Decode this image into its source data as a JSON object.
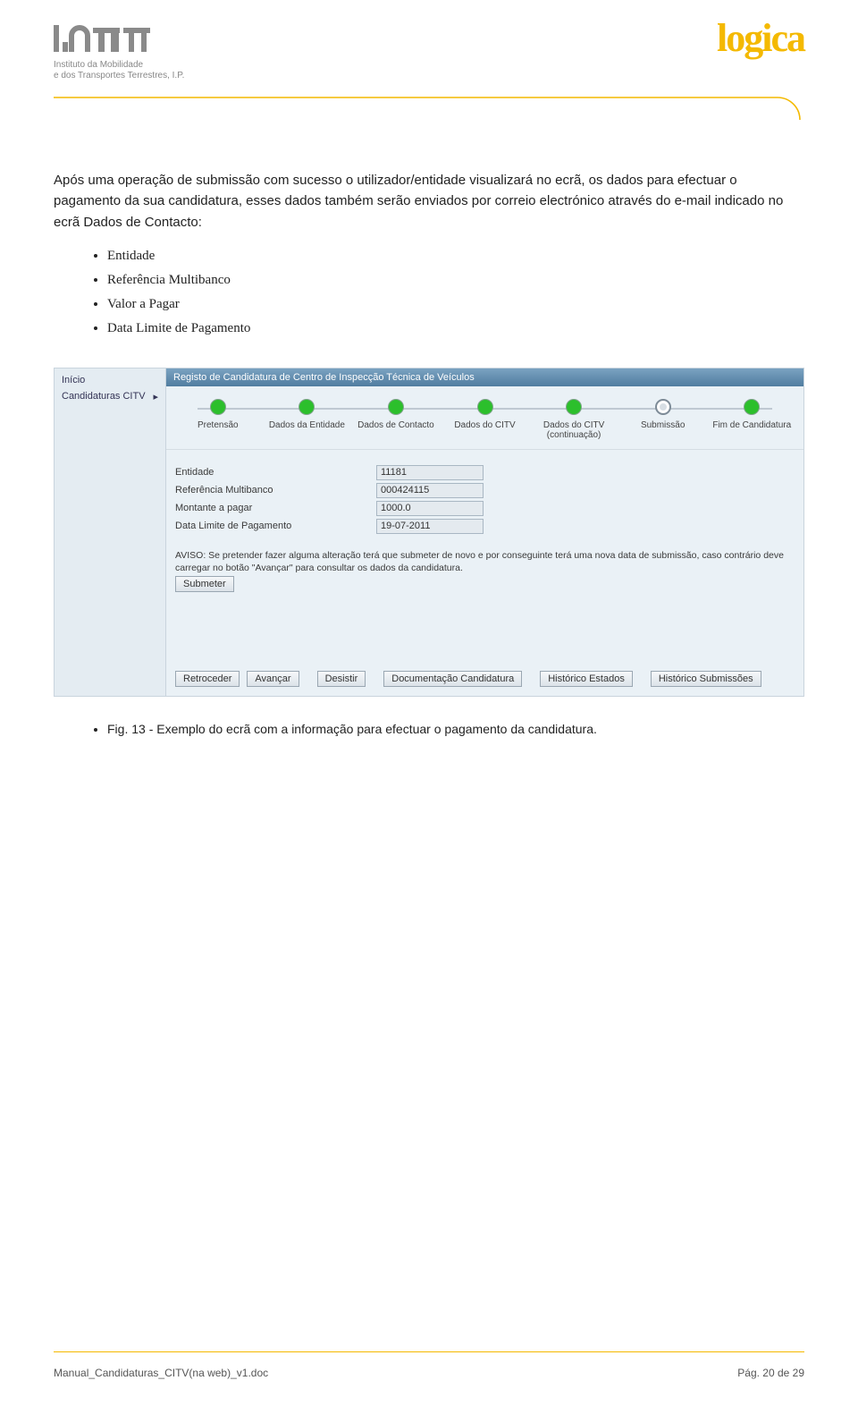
{
  "header": {
    "imtt_line1": "Instituto da Mobilidade",
    "imtt_line2": "e dos Transportes Terrestres, I.P.",
    "logica_text": "logica"
  },
  "intro_paragraph": "Após uma operação de submissão com sucesso o utilizador/entidade visualizará no ecrã, os dados para efectuar o pagamento da sua candidatura, esses dados também serão enviados por correio electrónico através do e-mail indicado no ecrã Dados de Contacto:",
  "bullets": [
    "Entidade",
    "Referência Multibanco",
    "Valor a Pagar",
    "Data Limite de Pagamento"
  ],
  "app": {
    "sidebar": {
      "items": [
        "Início",
        "Candidaturas CITV"
      ]
    },
    "title": "Registo de Candidatura de Centro de Inspecção Técnica de Veículos",
    "wizard_steps": [
      "Pretensão",
      "Dados da Entidade",
      "Dados de Contacto",
      "Dados do CITV",
      "Dados do CITV (continuação)",
      "Submissão",
      "Fim de Candidatura"
    ],
    "form": {
      "entidade_label": "Entidade",
      "entidade_value": "11181",
      "ref_label": "Referência Multibanco",
      "ref_value": "000424115",
      "montante_label": "Montante a pagar",
      "montante_value": "1000.0",
      "data_label": "Data Limite de Pagamento",
      "data_value": "19-07-2011"
    },
    "aviso": "AVISO: Se pretender fazer alguma alteração terá que submeter de novo e por conseguinte terá uma nova data de submissão, caso contrário deve carregar no botão \"Avançar\" para consultar os dados da candidatura.",
    "buttons": {
      "submeter": "Submeter",
      "retroceder": "Retroceder",
      "avancar": "Avançar",
      "desistir": "Desistir",
      "doc": "Documentação Candidatura",
      "hist_estados": "Histórico Estados",
      "hist_sub": "Histórico Submissões"
    }
  },
  "caption": "Fig. 13 - Exemplo do ecrã com a informação para efectuar o pagamento da candidatura.",
  "footer": {
    "left": "Manual_Candidaturas_CITV(na web)_v1.doc",
    "right": "Pág. 20 de 29"
  }
}
